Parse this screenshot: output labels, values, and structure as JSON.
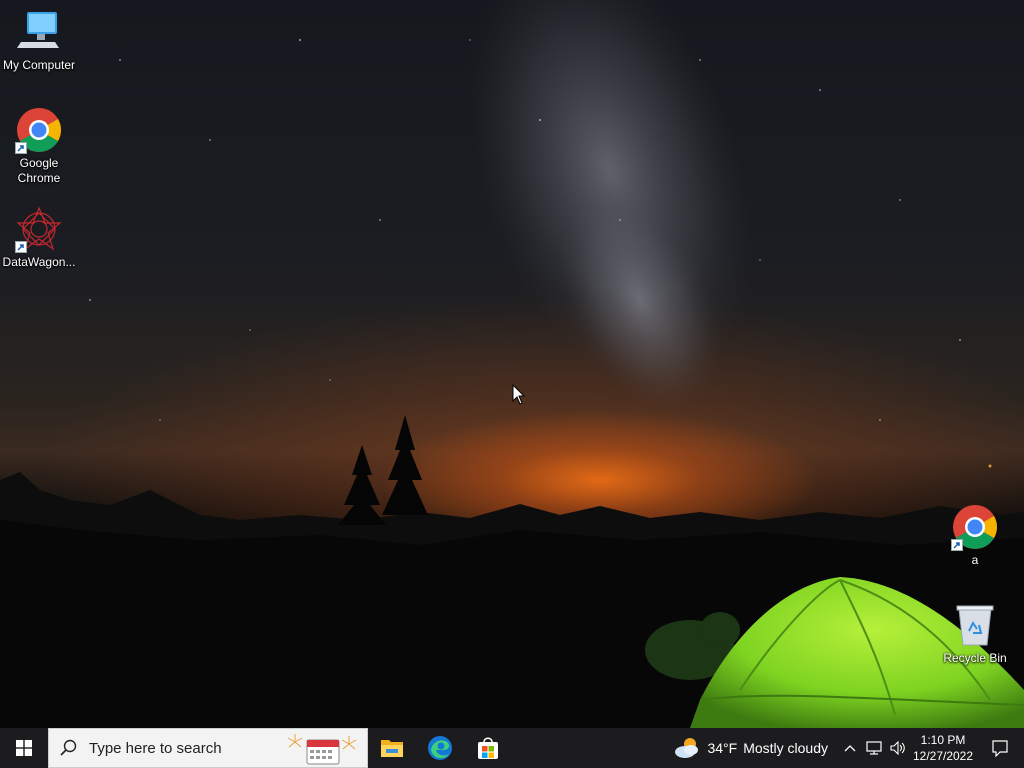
{
  "desktop": {
    "icons": [
      {
        "label": "My Computer",
        "icon": "computer-icon"
      },
      {
        "label": "Google Chrome",
        "icon": "chrome-icon"
      },
      {
        "label": "DataWagon...",
        "icon": "datawagon-icon"
      },
      {
        "label": "a",
        "icon": "chrome-icon"
      },
      {
        "label": "Recycle Bin",
        "icon": "recycle-bin-icon"
      }
    ]
  },
  "taskbar": {
    "search_placeholder": "Type here to search",
    "apps": [
      {
        "name": "File Explorer",
        "icon": "folder-icon"
      },
      {
        "name": "Microsoft Edge",
        "icon": "edge-icon"
      },
      {
        "name": "Microsoft Store",
        "icon": "store-icon"
      }
    ],
    "weather": {
      "temp": "34°F",
      "condition": "Mostly cloudy"
    },
    "clock": {
      "time": "1:10 PM",
      "date": "12/27/2022"
    }
  },
  "colors": {
    "taskbar": "#1c1c1f",
    "search_bg": "#f3f3f3",
    "tent_green": "#7ed321",
    "horizon_glow": "#e96c16"
  }
}
